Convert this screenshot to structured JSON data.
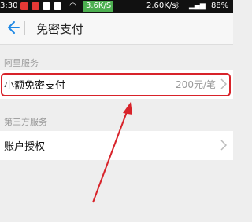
{
  "status_bar": {
    "time": "3:30",
    "net_speed_badge": "3.6K/S",
    "net_speed": "2.60K/s",
    "battery": "88%",
    "colors": {
      "background": "#111111",
      "badge": "#4caf50"
    }
  },
  "nav": {
    "back_icon": "back-arrow-icon",
    "title": "免密支付",
    "accent_color": "#1e88e5"
  },
  "sections": [
    {
      "label": "阿里服务",
      "rows": [
        {
          "label": "小额免密支付",
          "value": "200元/笔",
          "icon": "chevron-right-icon",
          "highlighted": true
        }
      ]
    },
    {
      "label": "第三方服务",
      "rows": [
        {
          "label": "账户授权",
          "value": "",
          "icon": "chevron-right-icon",
          "highlighted": false
        }
      ]
    }
  ],
  "annotation": {
    "highlight_color": "#d8232a",
    "arrow_color": "#d8232a"
  }
}
